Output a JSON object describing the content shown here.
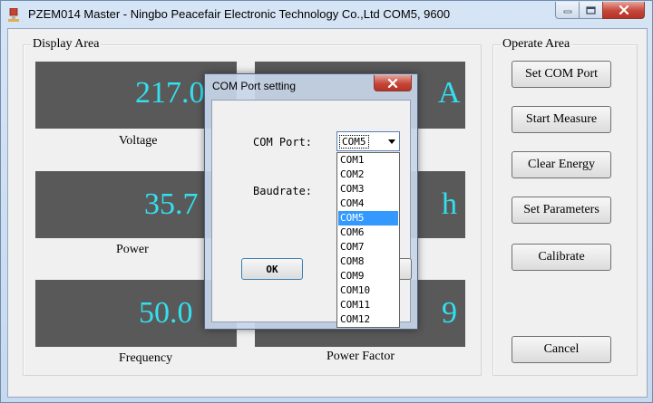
{
  "window": {
    "title": "PZEM014 Master - Ningbo Peacefair Electronic Technology Co.,Ltd  COM5, 9600",
    "icon": "plug-meter-icon",
    "controls": {
      "minimize": "minimize-icon",
      "maximize": "maximize-icon",
      "close": "close-icon"
    }
  },
  "display_area": {
    "label": "Display Area",
    "readouts": [
      {
        "id": "voltage",
        "value": "217.0",
        "label": "Voltage"
      },
      {
        "id": "current",
        "value": "A",
        "label": ""
      },
      {
        "id": "power",
        "value": "35.7",
        "label": "Power"
      },
      {
        "id": "energy",
        "value": "h",
        "label": ""
      },
      {
        "id": "frequency",
        "value": "50.0",
        "label": "Frequency"
      },
      {
        "id": "power_factor",
        "value": "9",
        "label": "Power Factor"
      }
    ]
  },
  "operate_area": {
    "label": "Operate Area",
    "buttons": [
      {
        "id": "set_com_port",
        "label": "Set COM Port"
      },
      {
        "id": "start_measure",
        "label": "Start Measure"
      },
      {
        "id": "clear_energy",
        "label": "Clear Energy"
      },
      {
        "id": "set_parameters",
        "label": "Set Parameters"
      },
      {
        "id": "calibrate",
        "label": "Calibrate"
      },
      {
        "id": "cancel",
        "label": "Cancel"
      }
    ]
  },
  "dialog": {
    "title": "COM Port setting",
    "com_port_label": "COM Port:",
    "baudrate_label": "Baudrate:",
    "com_port_value": "COM5",
    "com_options": [
      "COM1",
      "COM2",
      "COM3",
      "COM4",
      "COM5",
      "COM6",
      "COM7",
      "COM8",
      "COM9",
      "COM10",
      "COM11",
      "COM12"
    ],
    "selected_option": "COM5",
    "ok_label": "OK",
    "colors": {
      "selection": "#3399ff",
      "readout_text": "#33e0f0",
      "readout_bg": "#595959"
    }
  }
}
